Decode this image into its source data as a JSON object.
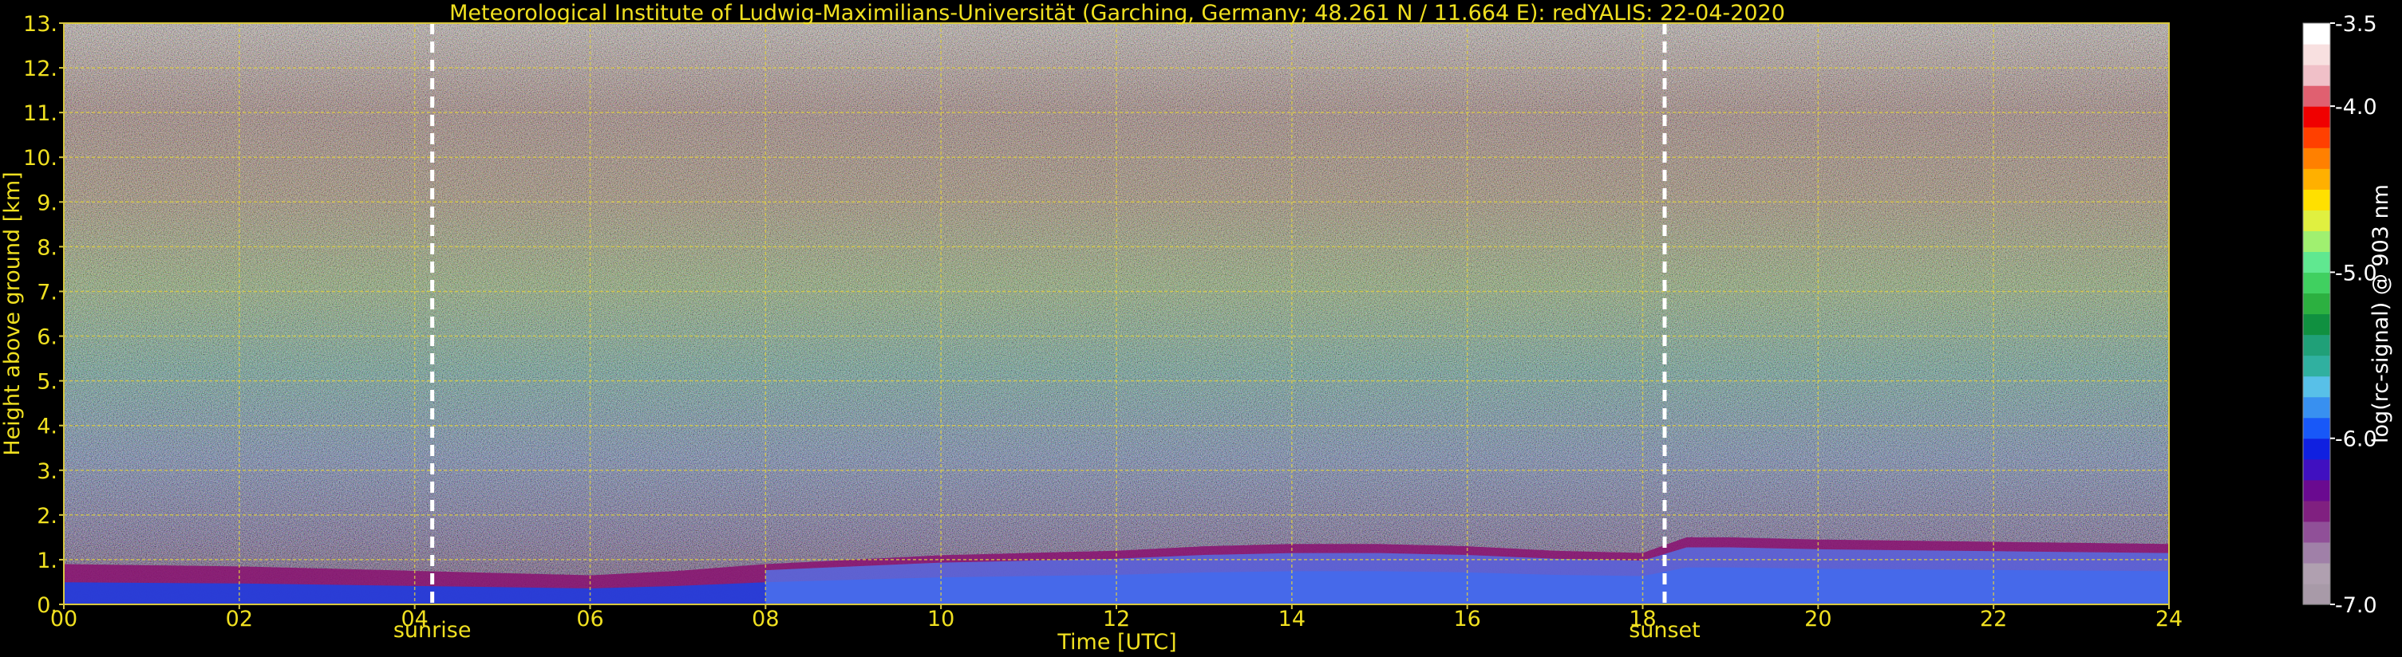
{
  "chart_data": {
    "type": "heatmap",
    "title": "Meteorological Institute of Ludwig-Maximilians-Universität (Garching, Germany; 48.261 N / 11.664 E):    redYALIS: 22-04-2020",
    "xlabel": "Time [UTC]",
    "ylabel": "Height above ground [km]",
    "xlim": [
      0,
      24
    ],
    "ylim": [
      0,
      13
    ],
    "x_ticks": [
      0,
      2,
      4,
      6,
      8,
      10,
      12,
      14,
      16,
      18,
      20,
      22,
      24
    ],
    "x_tick_labels": [
      "00",
      "02",
      "04",
      "06",
      "08",
      "10",
      "12",
      "14",
      "16",
      "18",
      "20",
      "22",
      "24"
    ],
    "y_ticks": [
      0,
      1,
      2,
      3,
      4,
      5,
      6,
      7,
      8,
      9,
      10,
      11,
      12,
      13
    ],
    "y_tick_labels": [
      "0.",
      "1.",
      "2.",
      "3.",
      "4.",
      "5.",
      "6.",
      "7.",
      "8.",
      "9.",
      "10.",
      "11.",
      "12.",
      "13."
    ],
    "grid": true,
    "colorbar": {
      "label": "log(rc-signal) @ 903 nm",
      "range": [
        -7.0,
        -3.5
      ],
      "tick_values": [
        -3.5,
        -4.0,
        -5.0,
        -6.0,
        -7.0
      ],
      "tick_labels": [
        "-3.5",
        "-4.0",
        "-5.0",
        "-6.0",
        "-7.0"
      ],
      "colors": [
        "#a89aa8",
        "#b0a0b0",
        "#a080a8",
        "#905098",
        "#802080",
        "#6a0a90",
        "#4010c0",
        "#1020e0",
        "#1858f8",
        "#3890f0",
        "#58c0e8",
        "#30b0a0",
        "#20a078",
        "#109040",
        "#2cb040",
        "#40d060",
        "#60e890",
        "#a0f070",
        "#e0f040",
        "#ffe000",
        "#ffb000",
        "#ff8000",
        "#ff4000",
        "#f00000",
        "#e06070",
        "#f0c0c8",
        "#f8e0e0",
        "#ffffff"
      ]
    },
    "annotations": [
      {
        "text": "sunrise",
        "x": 4.2
      },
      {
        "text": "sunset",
        "x": 18.25
      }
    ],
    "boundary_layer_top_km": {
      "x": [
        0,
        2,
        4,
        5,
        6,
        7,
        8,
        9,
        10,
        11,
        12,
        13,
        14,
        15,
        16,
        17,
        18,
        18.5,
        19,
        20,
        22,
        24
      ],
      "values": [
        0.9,
        0.85,
        0.75,
        0.7,
        0.65,
        0.75,
        0.9,
        1.0,
        1.1,
        1.15,
        1.2,
        1.3,
        1.35,
        1.35,
        1.3,
        1.2,
        1.15,
        1.5,
        1.5,
        1.45,
        1.4,
        1.35
      ]
    }
  }
}
